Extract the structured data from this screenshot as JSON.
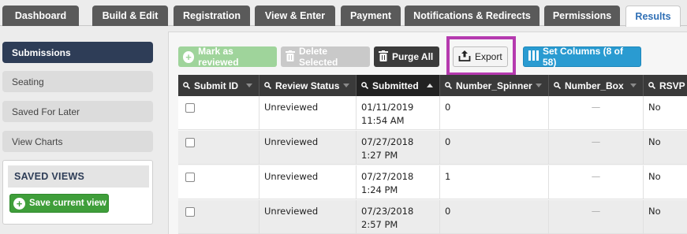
{
  "tabs": [
    {
      "label": "Dashboard",
      "active": false
    },
    {
      "label": "Build & Edit",
      "active": false
    },
    {
      "label": "Registration",
      "active": false
    },
    {
      "label": "View & Enter",
      "active": false
    },
    {
      "label": "Payment",
      "active": false
    },
    {
      "label": "Notifications & Redirects",
      "active": false
    },
    {
      "label": "Permissions",
      "active": false
    },
    {
      "label": "Results",
      "active": true
    }
  ],
  "sidebar": {
    "items": [
      {
        "label": "Submissions",
        "active": true
      },
      {
        "label": "Seating",
        "active": false
      },
      {
        "label": "Saved For Later",
        "active": false
      },
      {
        "label": "View Charts",
        "active": false
      }
    ],
    "saved_views": {
      "title": "SAVED VIEWS",
      "save_button": "Save current view"
    }
  },
  "toolbar": {
    "mark_reviewed": "Mark as reviewed",
    "delete_selected": "Delete Selected",
    "purge_all": "Purge All",
    "export": "Export",
    "set_columns": "Set Columns (8 of 58)"
  },
  "table": {
    "columns": [
      "Submit ID",
      "Review Status",
      "Submitted",
      "Number_Spinner",
      "Number_Box",
      "RSVP ("
    ],
    "sorted_column": "Submitted",
    "sort_direction": "asc",
    "rows": [
      {
        "status": "Unreviewed",
        "date": "01/11/2019",
        "time": "11:54 AM",
        "spinner": "0",
        "box": "—",
        "rsvp": "No"
      },
      {
        "status": "Unreviewed",
        "date": "07/27/2018",
        "time": "1:27 PM",
        "spinner": "0",
        "box": "—",
        "rsvp": "No"
      },
      {
        "status": "Unreviewed",
        "date": "07/27/2018",
        "time": "1:24 PM",
        "spinner": "1",
        "box": "—",
        "rsvp": "No"
      },
      {
        "status": "Unreviewed",
        "date": "07/23/2018",
        "time": "2:57 PM",
        "spinner": "0",
        "box": "—",
        "rsvp": "No"
      }
    ]
  },
  "colors": {
    "active_sidebar": "#2e3d57",
    "tab_dark": "#5a5a5a",
    "active_tab_text": "#2f6fb5",
    "export_highlight": "#b53aaf",
    "set_columns": "#2a9bd1",
    "save_view": "#3f9e3a"
  }
}
